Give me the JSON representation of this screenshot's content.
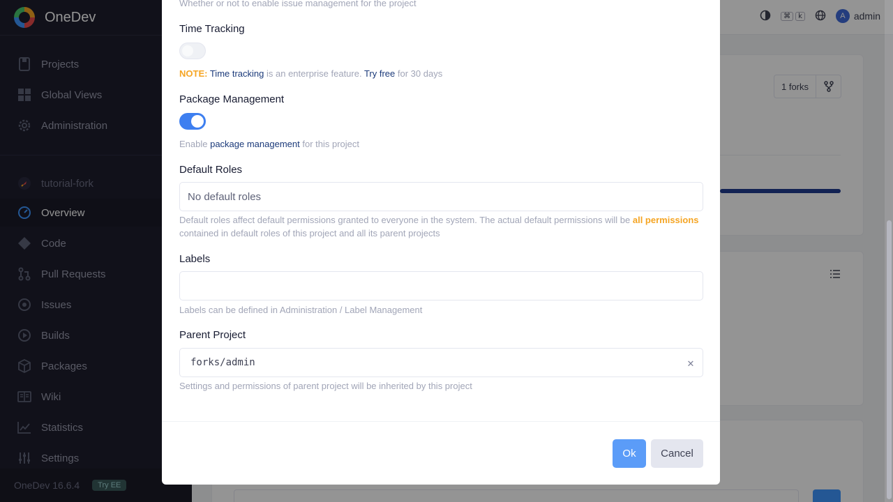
{
  "app": {
    "name": "OneDev"
  },
  "sidebar": {
    "top_items": [
      {
        "label": "Projects",
        "icon": "folder-icon"
      },
      {
        "label": "Global Views",
        "icon": "grid-icon"
      },
      {
        "label": "Administration",
        "icon": "gear-icon"
      }
    ],
    "project": {
      "name": "tutorial-fork",
      "icon": "rocket-icon"
    },
    "project_items": [
      {
        "label": "Overview",
        "icon": "dashboard-icon",
        "active": true
      },
      {
        "label": "Code",
        "icon": "code-icon"
      },
      {
        "label": "Pull Requests",
        "icon": "pull-request-icon"
      },
      {
        "label": "Issues",
        "icon": "issues-icon"
      },
      {
        "label": "Builds",
        "icon": "play-icon"
      },
      {
        "label": "Packages",
        "icon": "package-icon"
      },
      {
        "label": "Wiki",
        "icon": "book-icon"
      },
      {
        "label": "Statistics",
        "icon": "chart-icon"
      },
      {
        "label": "Settings",
        "icon": "sliders-icon"
      }
    ],
    "footer": {
      "version": "OneDev 16.6.4",
      "badge": "Try EE"
    }
  },
  "topbar": {
    "kbd1": "⌘",
    "kbd2": "k",
    "avatar_letter": "A",
    "user": "admin"
  },
  "background": {
    "forks_label": "1 forks"
  },
  "modal": {
    "top_help": "Whether or not to enable issue management for the project",
    "time_tracking": {
      "label": "Time Tracking",
      "enabled": false,
      "note_prefix": "NOTE:",
      "note_link1": "Time tracking",
      "note_mid": " is an enterprise feature. ",
      "note_link2": "Try free",
      "note_suffix": " for 30 days"
    },
    "package_management": {
      "label": "Package Management",
      "enabled": true,
      "help_prefix": "Enable ",
      "help_link": "package management",
      "help_suffix": " for this project"
    },
    "default_roles": {
      "label": "Default Roles",
      "value": "No default roles",
      "help_prefix": "Default roles affect default permissions granted to everyone in the system. The actual default permissions will be ",
      "help_emph": "all permissions",
      "help_suffix": " contained in default roles of this project and all its parent projects"
    },
    "labels": {
      "label": "Labels",
      "value": "",
      "help": "Labels can be defined in Administration / Label Management"
    },
    "parent_project": {
      "label": "Parent Project",
      "value": "forks/admin",
      "help": "Settings and permissions of parent project will be inherited by this project"
    },
    "ok_label": "Ok",
    "cancel_label": "Cancel"
  },
  "colors": {
    "primary": "#3e97ff",
    "warning": "#f5a524",
    "sidebar_bg": "#1e1e2d"
  }
}
